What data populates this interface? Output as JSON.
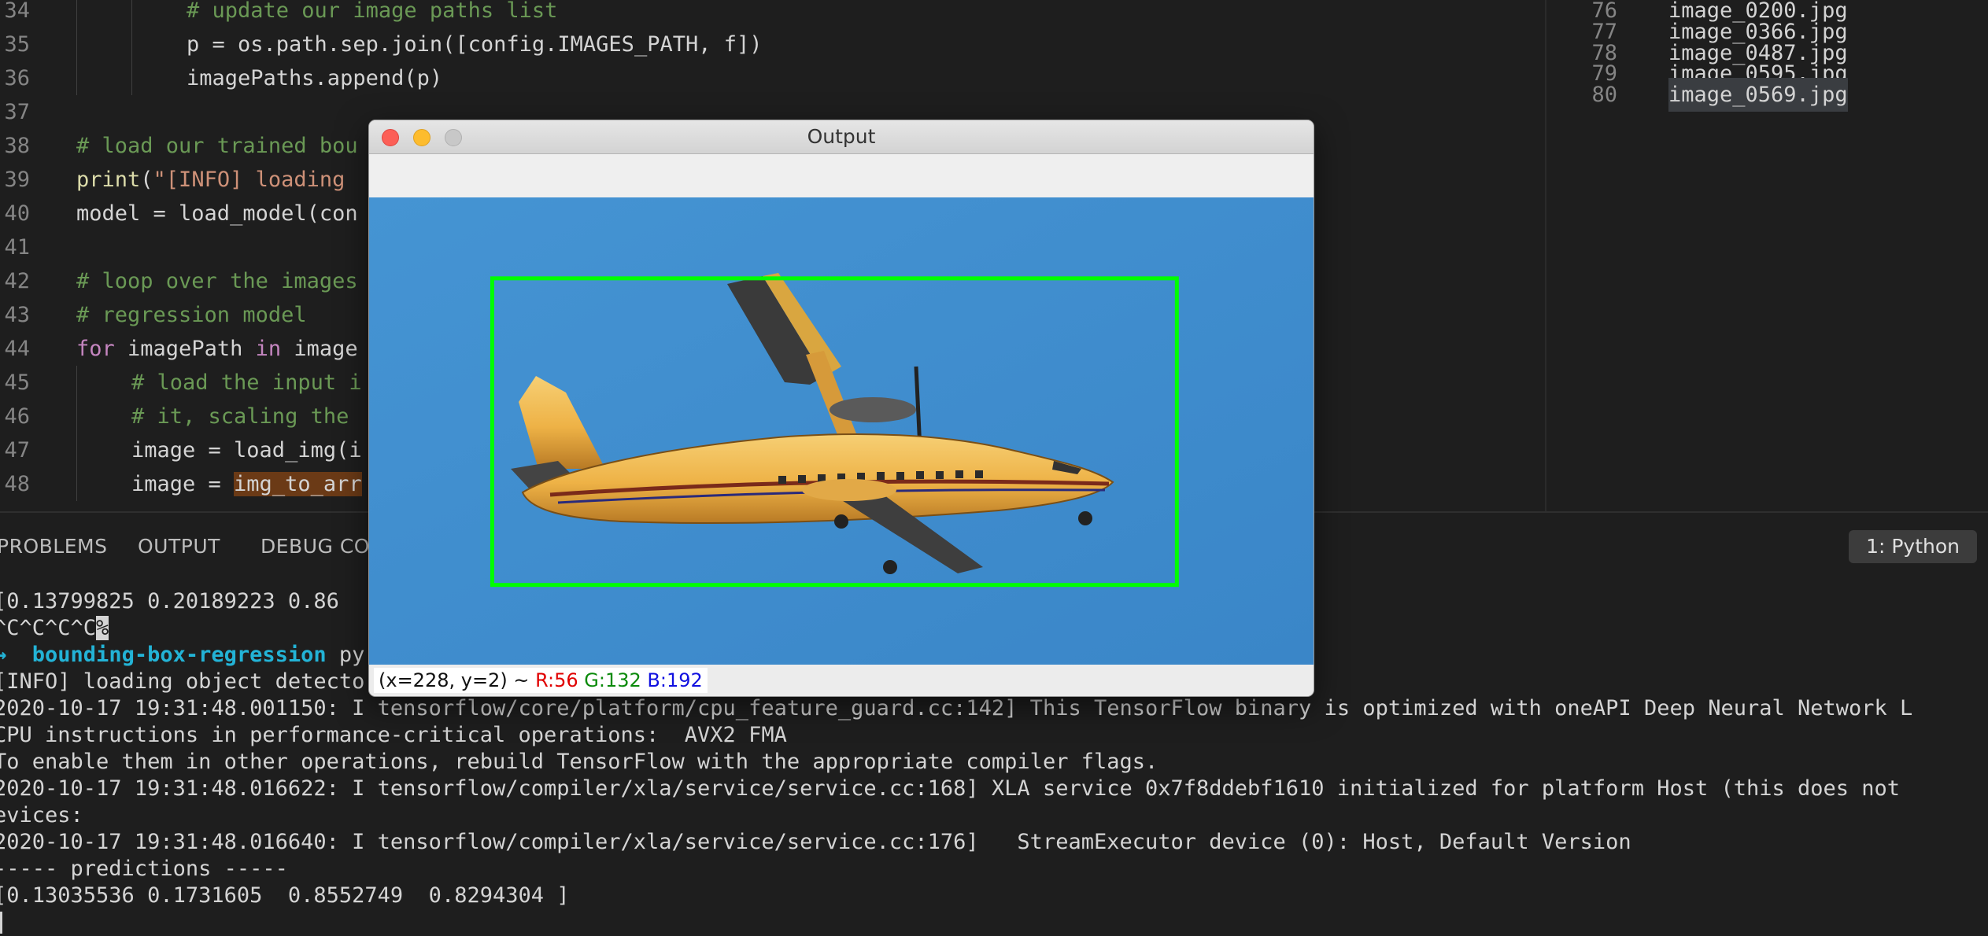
{
  "editor": {
    "lines": [
      {
        "num": "34",
        "indent": 2,
        "tokens": [
          {
            "t": "# update our image paths list",
            "c": "com"
          }
        ]
      },
      {
        "num": "35",
        "indent": 2,
        "tokens": [
          {
            "t": "p = os.path.sep.join([config.IMAGES_PATH, f])",
            "c": ""
          }
        ]
      },
      {
        "num": "36",
        "indent": 2,
        "tokens": [
          {
            "t": "imagePaths.append(p)",
            "c": ""
          }
        ]
      },
      {
        "num": "37",
        "indent": 0,
        "tokens": []
      },
      {
        "num": "38",
        "indent": 0,
        "tokens": [
          {
            "t": "# load our trained bou",
            "c": "com"
          }
        ]
      },
      {
        "num": "39",
        "indent": 0,
        "tokens": [
          {
            "t": "print",
            "c": "fn"
          },
          {
            "t": "(",
            "c": ""
          },
          {
            "t": "\"[INFO] loading",
            "c": "str"
          }
        ]
      },
      {
        "num": "40",
        "indent": 0,
        "tokens": [
          {
            "t": "model = load_model(con",
            "c": ""
          }
        ]
      },
      {
        "num": "41",
        "indent": 0,
        "tokens": []
      },
      {
        "num": "42",
        "indent": 0,
        "tokens": [
          {
            "t": "# loop over the images",
            "c": "com"
          }
        ]
      },
      {
        "num": "43",
        "indent": 0,
        "tokens": [
          {
            "t": "# regression model",
            "c": "com"
          }
        ]
      },
      {
        "num": "44",
        "indent": 0,
        "tokens": [
          {
            "t": "for",
            "c": "kw"
          },
          {
            "t": " imagePath ",
            "c": ""
          },
          {
            "t": "in",
            "c": "kw"
          },
          {
            "t": " image",
            "c": ""
          }
        ]
      },
      {
        "num": "45",
        "indent": 1,
        "tokens": [
          {
            "t": "# load the input i",
            "c": "com"
          }
        ]
      },
      {
        "num": "46",
        "indent": 1,
        "tokens": [
          {
            "t": "# it, scaling the",
            "c": "com"
          }
        ]
      },
      {
        "num": "47",
        "indent": 1,
        "tokens": [
          {
            "t": "image = load_img(i",
            "c": ""
          }
        ]
      },
      {
        "num": "48",
        "indent": 1,
        "tokens": [
          {
            "t": "image = ",
            "c": ""
          },
          {
            "t": "img_to_arr",
            "c": "hl"
          }
        ]
      }
    ]
  },
  "file_panel": {
    "lines": [
      {
        "num": "76",
        "text": "image_0200.jpg"
      },
      {
        "num": "77",
        "text": "image_0366.jpg"
      },
      {
        "num": "78",
        "text": "image_0487.jpg"
      },
      {
        "num": "79",
        "text": "image_0595.jpg"
      },
      {
        "num": "80",
        "text": "image_0569.jpg",
        "selected": true
      }
    ]
  },
  "panel": {
    "tabs": [
      "PROBLEMS",
      "OUTPUT",
      "DEBUG CO"
    ],
    "terminal_select": "1: Python"
  },
  "terminal": {
    "line1": "[0.13799825 0.20189223 0.86",
    "line2": "^C^C^C^C",
    "prompt_arrow": "→",
    "prompt_dir": "bounding-box-regression",
    "prompt_cmd": " py",
    "line4": "[INFO] loading object detecto",
    "line5": "2020-10-17 19:31:48.001150: I tensorflow/core/platform/cpu_feature_guard.cc:142] This TensorFlow binary is optimized with oneAPI Deep Neural Network L",
    "line6": "CPU instructions in performance-critical operations:  AVX2 FMA",
    "line7": "To enable them in other operations, rebuild TensorFlow with the appropriate compiler flags.",
    "line8": "2020-10-17 19:31:48.016622: I tensorflow/compiler/xla/service/service.cc:168] XLA service 0x7f8ddebf1610 initialized for platform Host (this does not",
    "line9": "evices:",
    "line10": "2020-10-17 19:31:48.016640: I tensorflow/compiler/xla/service/service.cc:176]   StreamExecutor device (0): Host, Default Version",
    "line11": "----- predictions -----",
    "line12": "[0.13035536 0.1731605  0.8552749  0.8294304 ]"
  },
  "output_window": {
    "title": "Output",
    "status": {
      "coords": "(x=228, y=2) ~ ",
      "r": "R:56",
      "g": "G:132",
      "b": "B:192"
    },
    "prediction_box": [
      0.13035536,
      0.1731605,
      0.8552749,
      0.8294304
    ],
    "colors": {
      "sky": "#3f8ecf",
      "box": "#00ff00",
      "fuselage": "#f2b84a"
    }
  }
}
